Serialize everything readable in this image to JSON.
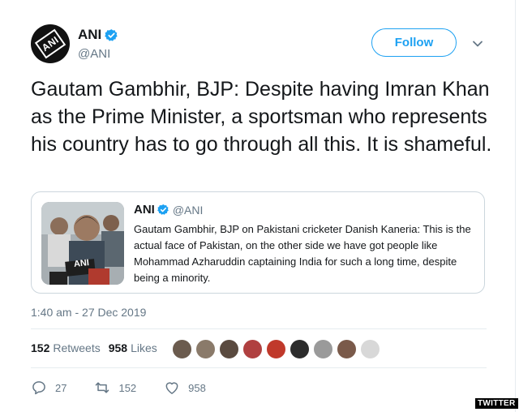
{
  "author": {
    "name": "ANI",
    "handle": "@ANI",
    "logo_text": "ANI"
  },
  "follow_label": "Follow",
  "tweet_text": "Gautam Gambhir, BJP: Despite having Imran Khan as the Prime Minister, a sportsman who represents his country has to go through all this. It is shameful.",
  "quoted": {
    "name": "ANI",
    "handle": "@ANI",
    "text": "Gautam Gambhir, BJP on Pakistani cricketer Danish Kaneria: This is the actual face of Pakistan, on the other side we have got people like Mohammad Azharuddin captaining India for such a long time, despite being a minority.",
    "mic_text": "ANI"
  },
  "timestamp": "1:40 am - 27 Dec 2019",
  "stats": {
    "retweets_count": "152",
    "retweets_label": "Retweets",
    "likes_count": "958",
    "likes_label": "Likes"
  },
  "liker_avatars": [
    "#6b5b4e",
    "#8a7a6a",
    "#5a4a3f",
    "#b04040",
    "#c0392b",
    "#2c2c2c",
    "#9a9a9a",
    "#7a5a4a",
    "#d8d8d8"
  ],
  "actions": {
    "reply_count": "27",
    "retweet_count": "152",
    "like_count": "958"
  },
  "watermark": "TWITTER",
  "colors": {
    "accent": "#1da1f2",
    "text": "#14171a",
    "muted": "#657786",
    "border": "#ccd6dd"
  }
}
